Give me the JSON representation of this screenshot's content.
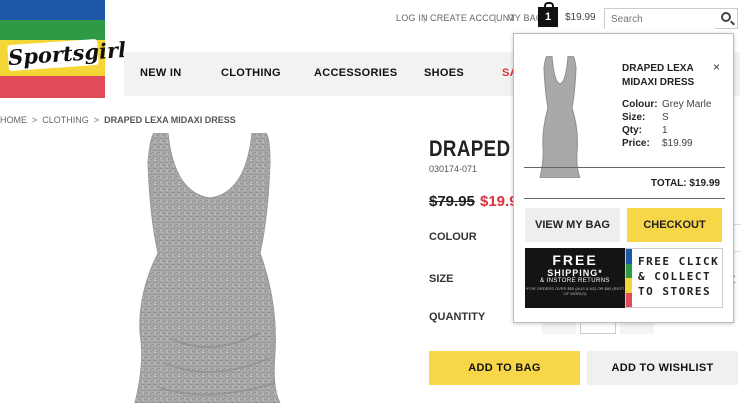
{
  "brand": {
    "logo_text": "Sportsgirl"
  },
  "header": {
    "login": "LOG IN",
    "sep1": "|",
    "create_account": "CREATE ACCOUNT",
    "sep2": "|",
    "my_bag": "MY BAG",
    "bag_count": "1",
    "bag_total": "$19.99",
    "search_placeholder": "Search"
  },
  "nav": {
    "items": [
      "NEW IN",
      "CLOTHING",
      "ACCESSORIES",
      "SHOES",
      "SA"
    ]
  },
  "breadcrumb": {
    "home": "HOME",
    "sep1": ">",
    "clothing": "CLOTHING",
    "sep2": ">",
    "current": "DRAPED LEXA MIDAXI DRESS"
  },
  "product": {
    "title_visible": "DRAPED L",
    "sku": "030174-071",
    "was_price": "$79.95",
    "now_price": "$19.9",
    "colour_label": "COLOUR",
    "size_label": "SIZE",
    "quantity_label": "QUANTITY",
    "add_to_bag": "ADD TO BAG",
    "add_to_wishlist": "ADD TO WISHLIST",
    "size_guide_partial": "?"
  },
  "mini_bag": {
    "product_name": "DRAPED LEXA MIDAXI DRESS",
    "close": "×",
    "details": [
      {
        "key": "Colour:",
        "value": "Grey Marle"
      },
      {
        "key": "Size:",
        "value": "S"
      },
      {
        "key": "Qty:",
        "value": "1"
      },
      {
        "key": "Price:",
        "value": "$19.99"
      }
    ],
    "total": "TOTAL: $19.99",
    "view_bag": "VIEW MY BAG",
    "checkout": "CHECKOUT",
    "promo_left": {
      "line1": "FREE",
      "line2": "SHIPPING*",
      "line3": "& INSTORE RETURNS",
      "line4": "*FOR ORDERS OVER $50 (AUS & NZ) OR $80 (REST OF WORLD)"
    },
    "promo_right": {
      "line1": "FREE CLICK",
      "line2": "& COLLECT",
      "line3": "TO STORES"
    }
  },
  "colors": {
    "accent_yellow": "#f7d747",
    "sale_red": "#d9333f",
    "logo_blue": "#1e56a8",
    "logo_green": "#2d9a45",
    "logo_yellow": "#f4d737",
    "logo_red": "#e14b58"
  }
}
